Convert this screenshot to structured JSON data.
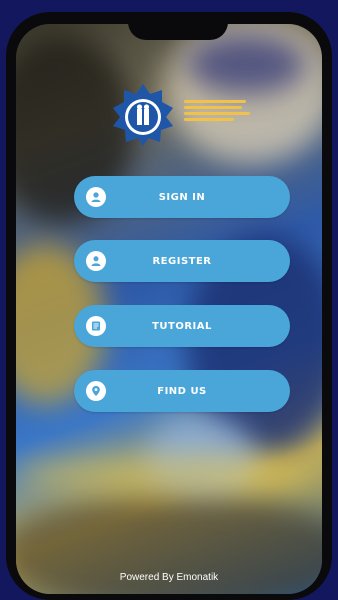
{
  "app": {
    "logo_icon": "organization-emblem",
    "colors": {
      "button": "#4aa6d9",
      "background": "#13185e",
      "logo_accent": "#f0c24a"
    }
  },
  "menu": [
    {
      "label": "SIGN IN",
      "icon": "user-icon"
    },
    {
      "label": "REGISTER",
      "icon": "account-icon"
    },
    {
      "label": "TUTORIAL",
      "icon": "book-icon"
    },
    {
      "label": "FIND US",
      "icon": "location-icon"
    }
  ],
  "footer": {
    "text": "Powered By Emonatik"
  }
}
